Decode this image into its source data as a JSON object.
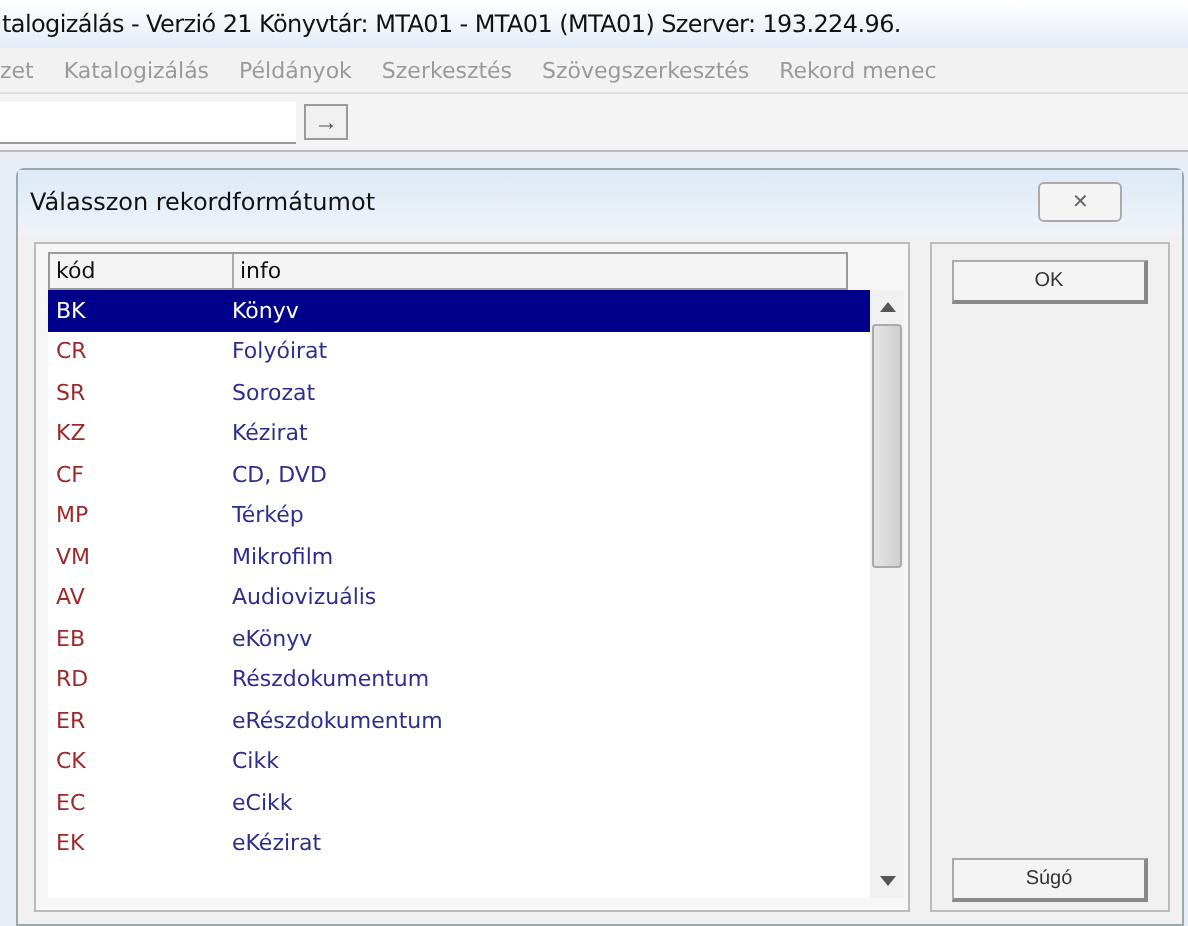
{
  "window": {
    "title": "talogizálás - Verzió 21  Könyvtár:  MTA01 - MTA01 (MTA01)  Szerver:  193.224.96."
  },
  "menu": [
    "zet",
    "Katalogizálás",
    "Példányok",
    "Szerkesztés",
    "Szövegszerkesztés",
    "Rekord menec"
  ],
  "toolbar": {
    "go_button": "→"
  },
  "dialog": {
    "title": "Válasszon rekordformátumot",
    "close": "✕",
    "table": {
      "columns": [
        "kód",
        "info"
      ],
      "rows": [
        {
          "code": "BK",
          "info": "Könyv",
          "selected": true
        },
        {
          "code": "CR",
          "info": "Folyóirat",
          "selected": false
        },
        {
          "code": "SR",
          "info": "Sorozat",
          "selected": false
        },
        {
          "code": "KZ",
          "info": "Kézirat",
          "selected": false
        },
        {
          "code": "CF",
          "info": "CD, DVD",
          "selected": false
        },
        {
          "code": "MP",
          "info": "Térkép",
          "selected": false
        },
        {
          "code": "VM",
          "info": "Mikrofilm",
          "selected": false
        },
        {
          "code": "AV",
          "info": "Audiovizuális",
          "selected": false
        },
        {
          "code": "EB",
          "info": "eKönyv",
          "selected": false
        },
        {
          "code": "RD",
          "info": "Részdokumentum",
          "selected": false
        },
        {
          "code": "ER",
          "info": "eRészdokumentum",
          "selected": false
        },
        {
          "code": "CK",
          "info": "Cikk",
          "selected": false
        },
        {
          "code": "EC",
          "info": "eCikk",
          "selected": false
        },
        {
          "code": "EK",
          "info": "eKézirat",
          "selected": false
        }
      ]
    },
    "buttons": [
      "OK",
      "Súgó"
    ]
  }
}
